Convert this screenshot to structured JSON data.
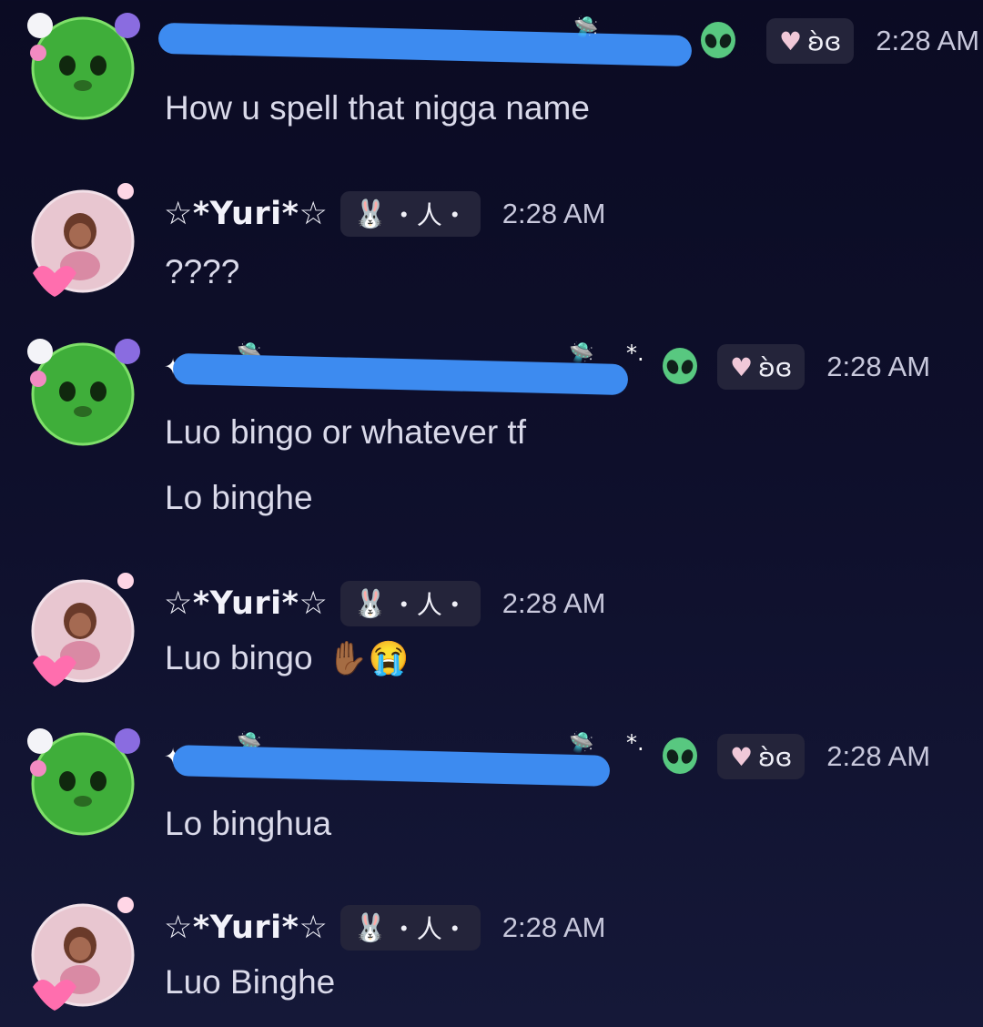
{
  "messages": [
    {
      "user": "alien",
      "tag_text": "ʚ̀ɞ",
      "time": "2:28 AM",
      "lines": [
        "How u spell that nigga name"
      ]
    },
    {
      "user": "yuri",
      "username": "☆*Yuri*☆",
      "tag_text": "・人・",
      "time": "2:28 AM",
      "lines": [
        "????"
      ]
    },
    {
      "user": "alien",
      "tag_text": "ʚ̀ɞ",
      "time": "2:28 AM",
      "lines": [
        "Luo bingo or whatever tf",
        "Lo binghe"
      ]
    },
    {
      "user": "yuri",
      "username": "☆*Yuri*☆",
      "tag_text": "・人・",
      "time": "2:28 AM",
      "lines": [
        "Luo bingo"
      ],
      "emojis": [
        "✋🏾",
        "😭"
      ]
    },
    {
      "user": "alien",
      "tag_text": "ʚ̀ɞ",
      "time": "2:28 AM",
      "lines": [
        "Lo binghua"
      ]
    },
    {
      "user": "yuri",
      "username": "☆*Yuri*☆",
      "tag_text": "・人・",
      "time": "2:28 AM",
      "lines": [
        "Luo Binghe"
      ]
    }
  ],
  "icons": {
    "alien": "alien-icon",
    "heart": "heart-icon",
    "bunny": "bunny-icon",
    "ufo": "ufo-icon"
  },
  "colors": {
    "background": "#0e0f2b",
    "tag_bg": "#24243a",
    "redaction": "#3d8bf0",
    "text": "#dadaea"
  }
}
